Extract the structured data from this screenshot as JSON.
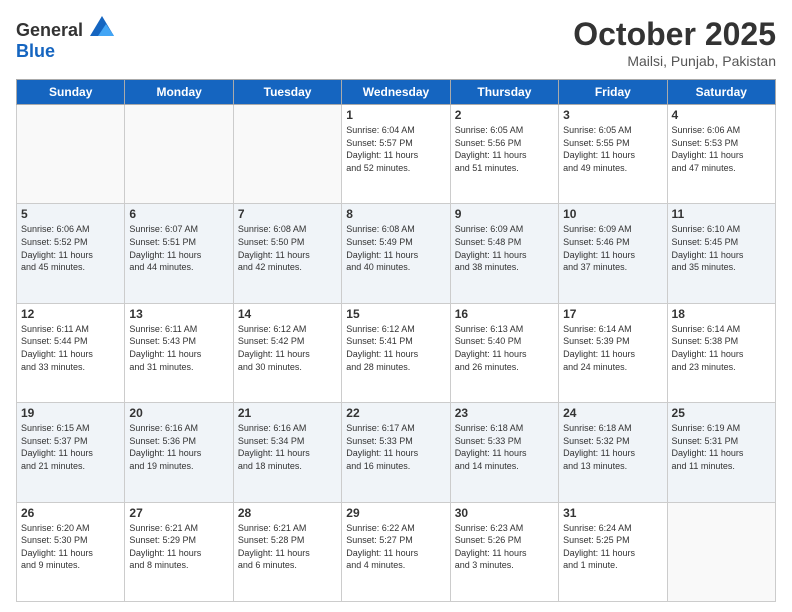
{
  "header": {
    "logo_general": "General",
    "logo_blue": "Blue",
    "month_title": "October 2025",
    "location": "Mailsi, Punjab, Pakistan"
  },
  "weekdays": [
    "Sunday",
    "Monday",
    "Tuesday",
    "Wednesday",
    "Thursday",
    "Friday",
    "Saturday"
  ],
  "weeks": [
    [
      {
        "day": "",
        "info": ""
      },
      {
        "day": "",
        "info": ""
      },
      {
        "day": "",
        "info": ""
      },
      {
        "day": "1",
        "info": "Sunrise: 6:04 AM\nSunset: 5:57 PM\nDaylight: 11 hours\nand 52 minutes."
      },
      {
        "day": "2",
        "info": "Sunrise: 6:05 AM\nSunset: 5:56 PM\nDaylight: 11 hours\nand 51 minutes."
      },
      {
        "day": "3",
        "info": "Sunrise: 6:05 AM\nSunset: 5:55 PM\nDaylight: 11 hours\nand 49 minutes."
      },
      {
        "day": "4",
        "info": "Sunrise: 6:06 AM\nSunset: 5:53 PM\nDaylight: 11 hours\nand 47 minutes."
      }
    ],
    [
      {
        "day": "5",
        "info": "Sunrise: 6:06 AM\nSunset: 5:52 PM\nDaylight: 11 hours\nand 45 minutes."
      },
      {
        "day": "6",
        "info": "Sunrise: 6:07 AM\nSunset: 5:51 PM\nDaylight: 11 hours\nand 44 minutes."
      },
      {
        "day": "7",
        "info": "Sunrise: 6:08 AM\nSunset: 5:50 PM\nDaylight: 11 hours\nand 42 minutes."
      },
      {
        "day": "8",
        "info": "Sunrise: 6:08 AM\nSunset: 5:49 PM\nDaylight: 11 hours\nand 40 minutes."
      },
      {
        "day": "9",
        "info": "Sunrise: 6:09 AM\nSunset: 5:48 PM\nDaylight: 11 hours\nand 38 minutes."
      },
      {
        "day": "10",
        "info": "Sunrise: 6:09 AM\nSunset: 5:46 PM\nDaylight: 11 hours\nand 37 minutes."
      },
      {
        "day": "11",
        "info": "Sunrise: 6:10 AM\nSunset: 5:45 PM\nDaylight: 11 hours\nand 35 minutes."
      }
    ],
    [
      {
        "day": "12",
        "info": "Sunrise: 6:11 AM\nSunset: 5:44 PM\nDaylight: 11 hours\nand 33 minutes."
      },
      {
        "day": "13",
        "info": "Sunrise: 6:11 AM\nSunset: 5:43 PM\nDaylight: 11 hours\nand 31 minutes."
      },
      {
        "day": "14",
        "info": "Sunrise: 6:12 AM\nSunset: 5:42 PM\nDaylight: 11 hours\nand 30 minutes."
      },
      {
        "day": "15",
        "info": "Sunrise: 6:12 AM\nSunset: 5:41 PM\nDaylight: 11 hours\nand 28 minutes."
      },
      {
        "day": "16",
        "info": "Sunrise: 6:13 AM\nSunset: 5:40 PM\nDaylight: 11 hours\nand 26 minutes."
      },
      {
        "day": "17",
        "info": "Sunrise: 6:14 AM\nSunset: 5:39 PM\nDaylight: 11 hours\nand 24 minutes."
      },
      {
        "day": "18",
        "info": "Sunrise: 6:14 AM\nSunset: 5:38 PM\nDaylight: 11 hours\nand 23 minutes."
      }
    ],
    [
      {
        "day": "19",
        "info": "Sunrise: 6:15 AM\nSunset: 5:37 PM\nDaylight: 11 hours\nand 21 minutes."
      },
      {
        "day": "20",
        "info": "Sunrise: 6:16 AM\nSunset: 5:36 PM\nDaylight: 11 hours\nand 19 minutes."
      },
      {
        "day": "21",
        "info": "Sunrise: 6:16 AM\nSunset: 5:34 PM\nDaylight: 11 hours\nand 18 minutes."
      },
      {
        "day": "22",
        "info": "Sunrise: 6:17 AM\nSunset: 5:33 PM\nDaylight: 11 hours\nand 16 minutes."
      },
      {
        "day": "23",
        "info": "Sunrise: 6:18 AM\nSunset: 5:33 PM\nDaylight: 11 hours\nand 14 minutes."
      },
      {
        "day": "24",
        "info": "Sunrise: 6:18 AM\nSunset: 5:32 PM\nDaylight: 11 hours\nand 13 minutes."
      },
      {
        "day": "25",
        "info": "Sunrise: 6:19 AM\nSunset: 5:31 PM\nDaylight: 11 hours\nand 11 minutes."
      }
    ],
    [
      {
        "day": "26",
        "info": "Sunrise: 6:20 AM\nSunset: 5:30 PM\nDaylight: 11 hours\nand 9 minutes."
      },
      {
        "day": "27",
        "info": "Sunrise: 6:21 AM\nSunset: 5:29 PM\nDaylight: 11 hours\nand 8 minutes."
      },
      {
        "day": "28",
        "info": "Sunrise: 6:21 AM\nSunset: 5:28 PM\nDaylight: 11 hours\nand 6 minutes."
      },
      {
        "day": "29",
        "info": "Sunrise: 6:22 AM\nSunset: 5:27 PM\nDaylight: 11 hours\nand 4 minutes."
      },
      {
        "day": "30",
        "info": "Sunrise: 6:23 AM\nSunset: 5:26 PM\nDaylight: 11 hours\nand 3 minutes."
      },
      {
        "day": "31",
        "info": "Sunrise: 6:24 AM\nSunset: 5:25 PM\nDaylight: 11 hours\nand 1 minute."
      },
      {
        "day": "",
        "info": ""
      }
    ]
  ]
}
